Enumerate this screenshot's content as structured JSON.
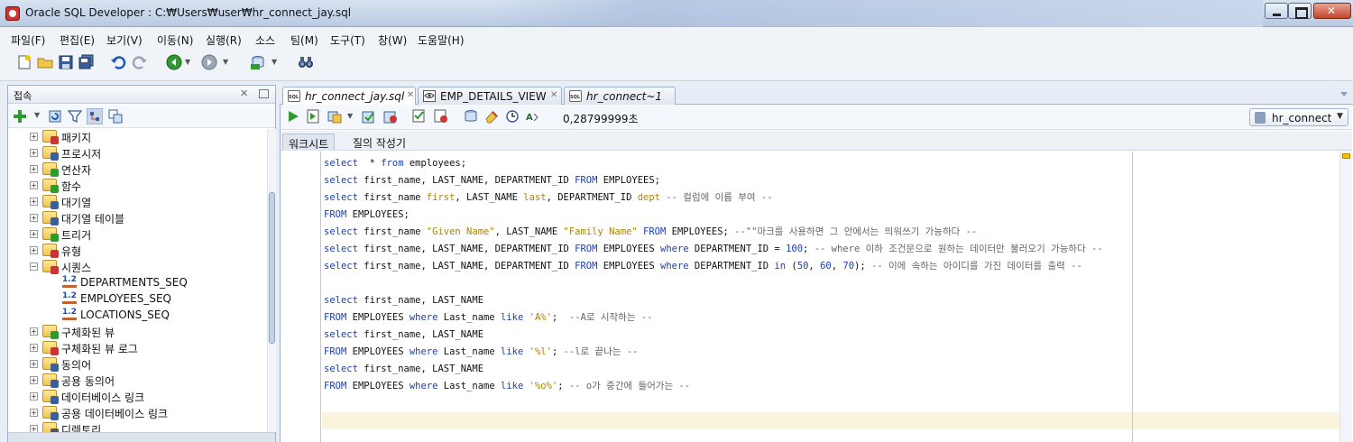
{
  "window": {
    "title": "Oracle SQL Developer : C:₩Users₩user₩hr_connect_jay.sql"
  },
  "menu": [
    "파일(F)",
    "편집(E)",
    "보기(V)",
    "이동(N)",
    "실행(R)",
    "소스",
    "팀(M)",
    "도구(T)",
    "창(W)",
    "도움말(H)"
  ],
  "toolbar": {
    "icons": [
      "new-file-icon",
      "open-folder-icon",
      "save-icon",
      "save-all-icon",
      "undo-icon",
      "redo-icon",
      "back-icon",
      "forward-icon",
      "sql-icon",
      "binoculars-icon"
    ]
  },
  "connections_panel": {
    "title": "접속",
    "tree": [
      {
        "label": "패키지",
        "expanded": false
      },
      {
        "label": "프로시저",
        "expanded": false
      },
      {
        "label": "연산자",
        "expanded": false
      },
      {
        "label": "함수",
        "expanded": false
      },
      {
        "label": "대기열",
        "expanded": false
      },
      {
        "label": "대기열 테이블",
        "expanded": false
      },
      {
        "label": "트리거",
        "expanded": false
      },
      {
        "label": "유형",
        "expanded": false
      },
      {
        "label": "시퀀스",
        "expanded": true
      },
      {
        "label": "DEPARTMENTS_SEQ",
        "child": true
      },
      {
        "label": "EMPLOYEES_SEQ",
        "child": true
      },
      {
        "label": "LOCATIONS_SEQ",
        "child": true
      },
      {
        "label": "구체화된 뷰",
        "expanded": false
      },
      {
        "label": "구체화된 뷰 로그",
        "expanded": false
      },
      {
        "label": "동의어",
        "expanded": false
      },
      {
        "label": "공용 동의어",
        "expanded": false
      },
      {
        "label": "데이터베이스 링크",
        "expanded": false
      },
      {
        "label": "공용 데이터베이스 링크",
        "expanded": false
      },
      {
        "label": "디렉토리",
        "expanded": false
      }
    ]
  },
  "editor_tabs": [
    {
      "label": "hr_connect_jay.sql",
      "active": true
    },
    {
      "label": "EMP_DETAILS_VIEW",
      "active": false
    },
    {
      "label": "hr_connect~1",
      "active": false
    }
  ],
  "editor_toolbar": {
    "timing": "0,28799999초",
    "connection": "hr_connect"
  },
  "subtabs": [
    "워크시트",
    "질의 작성기"
  ],
  "code_lines": [
    [
      [
        "k",
        "select"
      ],
      [
        "",
        "  * "
      ],
      [
        "k",
        "from"
      ],
      [
        "",
        " employees;"
      ]
    ],
    [
      [
        "k",
        "select"
      ],
      [
        "",
        " first_name, LAST_NAME, DEPARTMENT_ID "
      ],
      [
        "k",
        "FROM"
      ],
      [
        "",
        " EMPLOYEES;"
      ]
    ],
    [
      [
        "k",
        "select"
      ],
      [
        "",
        " first_name "
      ],
      [
        "s",
        "first"
      ],
      [
        "",
        ", LAST_NAME "
      ],
      [
        "s",
        "last"
      ],
      [
        "",
        ", DEPARTMENT_ID "
      ],
      [
        "s",
        "dept"
      ],
      [
        "c",
        " -- 컬럼에 이름 부여 --"
      ]
    ],
    [
      [
        "k",
        "FROM"
      ],
      [
        "",
        " EMPLOYEES;"
      ]
    ],
    [
      [
        "k",
        "select"
      ],
      [
        "",
        " first_name "
      ],
      [
        "s",
        "\"Given Name\""
      ],
      [
        "",
        ", LAST_NAME "
      ],
      [
        "s",
        "\"Family Name\""
      ],
      [
        "",
        ""
      ],
      [
        "k",
        " FROM"
      ],
      [
        "",
        " EMPLOYEES; "
      ],
      [
        "c",
        "--\"\"마크를 사용하면 그 안에서는 띄워쓰기 가능하다 --"
      ]
    ],
    [
      [
        "k",
        "select"
      ],
      [
        "",
        " first_name, LAST_NAME, DEPARTMENT_ID "
      ],
      [
        "k",
        "FROM"
      ],
      [
        "",
        " EMPLOYEES "
      ],
      [
        "k",
        "where"
      ],
      [
        "",
        " DEPARTMENT_ID = "
      ],
      [
        "n",
        "100"
      ],
      [
        "",
        ";"
      ],
      [
        "c",
        " -- where 이하 조건문으로 원하는 데이터만 불러오기 가능하다 --"
      ]
    ],
    [
      [
        "k",
        "select"
      ],
      [
        "",
        " first_name, LAST_NAME, DEPARTMENT_ID "
      ],
      [
        "k",
        "FROM"
      ],
      [
        "",
        " EMPLOYEES "
      ],
      [
        "k",
        "where"
      ],
      [
        "",
        " DEPARTMENT_ID "
      ],
      [
        "k",
        "in"
      ],
      [
        "",
        " ("
      ],
      [
        "n",
        "50"
      ],
      [
        "",
        ", "
      ],
      [
        "n",
        "60"
      ],
      [
        "",
        ", "
      ],
      [
        "n",
        "70"
      ],
      [
        "",
        ");"
      ],
      [
        "c",
        " -- 이에 속하는 아이디를 가진 데이터를 출력 --"
      ]
    ],
    [],
    [
      [
        "k",
        "select"
      ],
      [
        "",
        " first_name, LAST_NAME"
      ]
    ],
    [
      [
        "k",
        "FROM"
      ],
      [
        "",
        " EMPLOYEES "
      ],
      [
        "k",
        "where"
      ],
      [
        "",
        " Last_name "
      ],
      [
        "k",
        "like"
      ],
      [
        "",
        " "
      ],
      [
        "s",
        "'A%'"
      ],
      [
        "",
        ";  "
      ],
      [
        "c",
        "--A로 시작하는 --"
      ]
    ],
    [
      [
        "k",
        "select"
      ],
      [
        "",
        " first_name, LAST_NAME"
      ]
    ],
    [
      [
        "k",
        "FROM"
      ],
      [
        "",
        " EMPLOYEES "
      ],
      [
        "k",
        "where"
      ],
      [
        "",
        " Last_name "
      ],
      [
        "k",
        "like"
      ],
      [
        "",
        " "
      ],
      [
        "s",
        "'%l'"
      ],
      [
        "",
        "; "
      ],
      [
        "c",
        "--l로 끝나는 --"
      ]
    ],
    [
      [
        "k",
        "select"
      ],
      [
        "",
        " first_name, LAST_NAME"
      ]
    ],
    [
      [
        "k",
        "FROM"
      ],
      [
        "",
        " EMPLOYEES "
      ],
      [
        "k",
        "where"
      ],
      [
        "",
        " Last_name "
      ],
      [
        "k",
        "like"
      ],
      [
        "",
        " "
      ],
      [
        "s",
        "'%o%'"
      ],
      [
        "",
        "; "
      ],
      [
        "c",
        "-- o가 중간에 들어가는 --"
      ]
    ]
  ]
}
